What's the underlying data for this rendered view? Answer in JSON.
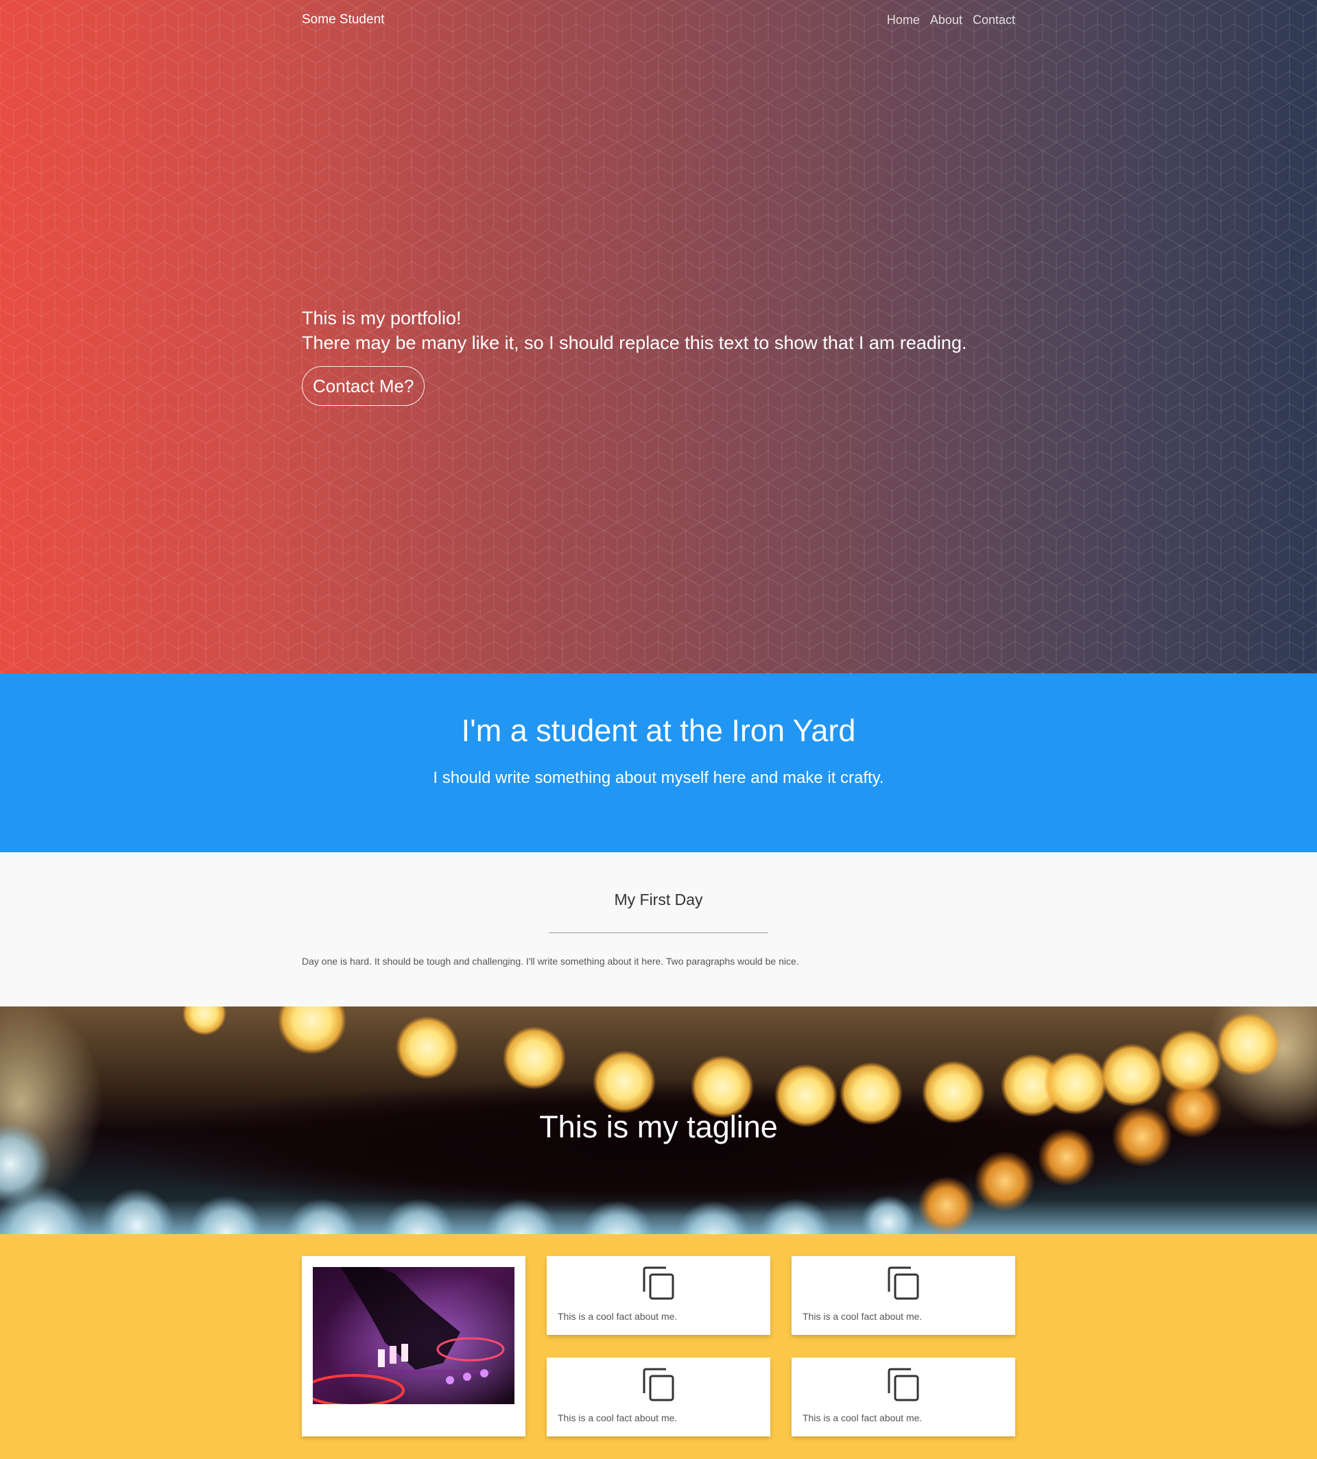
{
  "nav": {
    "brand": "Some Student",
    "links": [
      "Home",
      "About",
      "Contact"
    ]
  },
  "hero": {
    "line1": "This is my portfolio!",
    "line2": "There may be many like it, so I should replace this text to show that I am reading.",
    "button": "Contact Me?"
  },
  "about": {
    "title": "I'm a student at the Iron Yard",
    "text": "I should write something about myself here and make it crafty."
  },
  "post": {
    "title": "My First Day",
    "text": "Day one is hard. It should be tough and challenging. I'll write something about it here. Two paragraphs would be nice."
  },
  "tagline": {
    "text": "This is my tagline"
  },
  "facts": {
    "icon": "copy-icon",
    "items": [
      "This is a cool fact about me.",
      "This is a cool fact about me.",
      "This is a cool fact about me.",
      "This is a cool fact about me."
    ]
  },
  "colors": {
    "hero_start": "#e84d43",
    "hero_end": "#2f3a54",
    "about_bg": "#2196f3",
    "post_bg": "#f9f9f9",
    "facts_bg": "#fcc748"
  }
}
